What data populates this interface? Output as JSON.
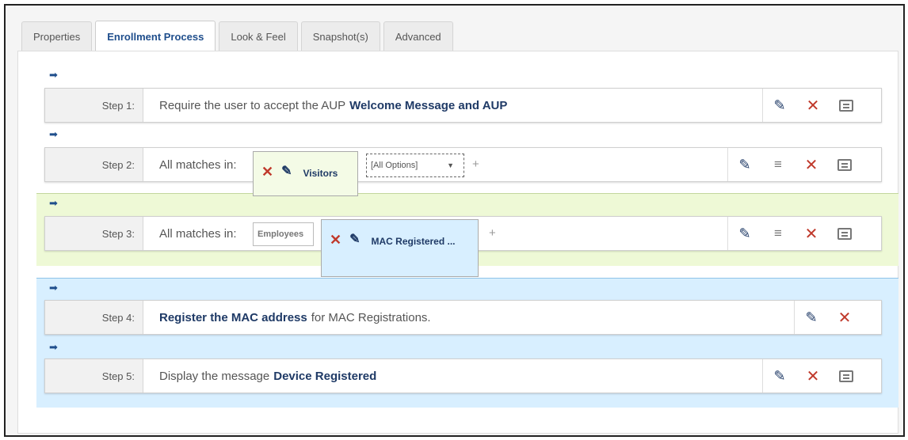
{
  "tabs": [
    {
      "label": "Properties",
      "active": false
    },
    {
      "label": "Enrollment Process",
      "active": true
    },
    {
      "label": "Look & Feel",
      "active": false
    },
    {
      "label": "Snapshot(s)",
      "active": false
    },
    {
      "label": "Advanced",
      "active": false
    }
  ],
  "colors": {
    "accent": "#1f4e8c",
    "delete": "#c0392b",
    "green_zone": "#eef9d6",
    "blue_zone": "#d8efff"
  },
  "icons": {
    "arrow": "arrow-right-icon",
    "edit": "pencil-icon",
    "delete": "close-icon",
    "reorder": "menu-lines-icon",
    "message": "message-icon"
  },
  "steps": [
    {
      "label": "Step 1:",
      "text": "Require the user to accept the AUP",
      "bold": "Welcome Message and AUP"
    },
    {
      "label": "Step 2:",
      "text": "All matches in:",
      "chip_visitors": "Visitors",
      "dropdown": "[All Options]",
      "dropdown_arrow": "▼",
      "plus": "+"
    },
    {
      "label": "Step 3:",
      "text": "All matches in:",
      "chip_employees": "Employees",
      "chip_mac": "MAC Registered ...",
      "plus": "+"
    },
    {
      "label": "Step 4:",
      "bold": "Register the MAC address",
      "text": "for MAC Registrations."
    },
    {
      "label": "Step 5:",
      "text": "Display the message",
      "bold": "Device Registered"
    }
  ],
  "glyphs": {
    "arrow": "➡",
    "pencil": "✎",
    "x": "✕",
    "lines": "≡"
  }
}
